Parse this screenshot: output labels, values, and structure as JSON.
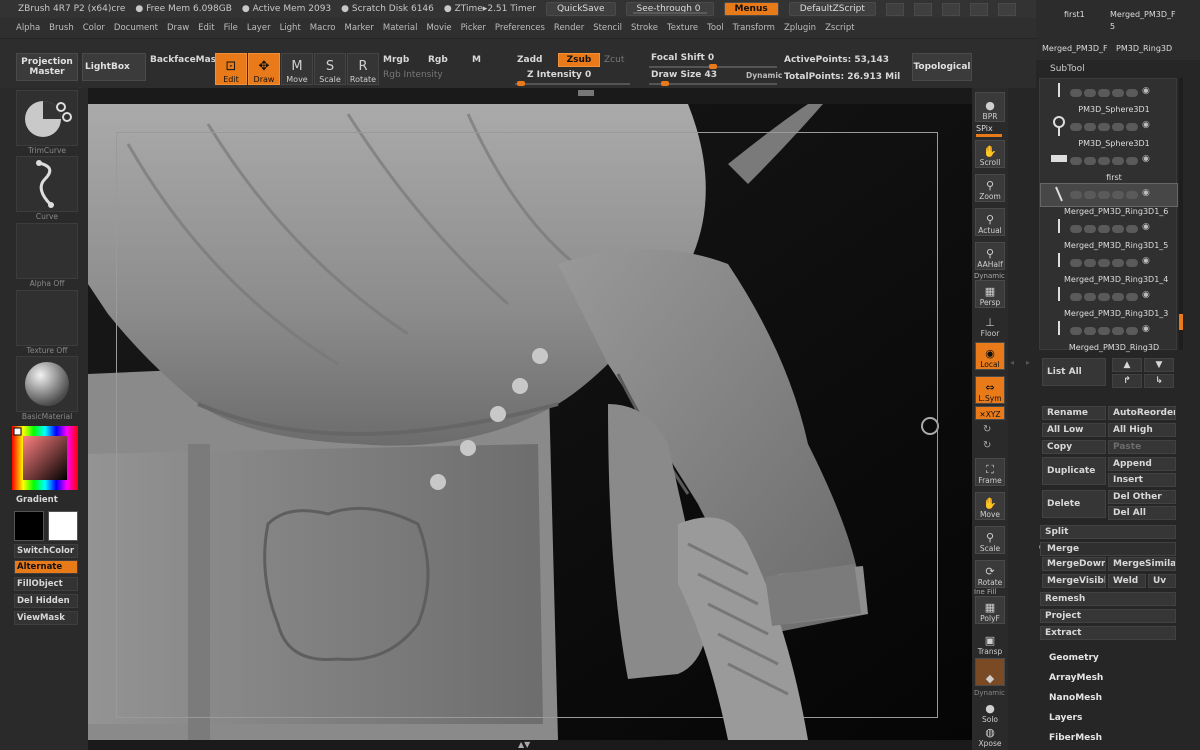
{
  "titlebar": {
    "app": "ZBrush 4R7 P2 (x64)cre",
    "free_mem": "● Free Mem 6.098GB",
    "active_mem": "● Active Mem 2093",
    "scratch": "● Scratch Disk 6146",
    "ztime": "● ZTime▸2.51 Timer",
    "quicksave": "QuickSave",
    "see_through": "See-through  0",
    "menus": "Menus",
    "script": "DefaultZScript"
  },
  "menus": [
    "Alpha",
    "Brush",
    "Color",
    "Document",
    "Draw",
    "Edit",
    "File",
    "Layer",
    "Light",
    "Macro",
    "Marker",
    "Material",
    "Movie",
    "Picker",
    "Preferences",
    "Render",
    "Stencil",
    "Stroke",
    "Texture",
    "Tool",
    "Transform",
    "Zplugin",
    "Zscript"
  ],
  "toolbar": {
    "projection_master": "Projection Master",
    "lightbox": "LightBox",
    "backface": "BackfaceMas",
    "edit": "Edit",
    "draw": "Draw",
    "move": "Move",
    "scale": "Scale",
    "rotate": "Rotate",
    "mrgb": "Mrgb",
    "rgb": "Rgb",
    "m": "M",
    "rgb_intensity": "Rgb Intensity",
    "zadd": "Zadd",
    "zsub": "Zsub",
    "zcut": "Zcut",
    "z_intensity": "Z Intensity 0",
    "focal_shift": "Focal Shift 0",
    "draw_size": "Draw Size 43",
    "dynamic": "Dynamic",
    "active_points": "ActivePoints: 53,143",
    "total_points": "TotalPoints: 26.913 Mil",
    "topological": "Topological"
  },
  "left": {
    "trimcurve": "TrimCurve",
    "curve": "Curve",
    "alpha_off": "Alpha Off",
    "texture_off": "Texture Off",
    "material": "BasicMaterial",
    "gradient": "Gradient",
    "switchcolor": "SwitchColor",
    "alternate": "Alternate",
    "fillobject": "FillObject",
    "del_hidden": "Del Hidden",
    "viewmask": "ViewMask"
  },
  "right_shelf": {
    "bpr": "BPR",
    "spix": "SPix",
    "scroll": "Scroll",
    "zoom": "Zoom",
    "actual": "Actual",
    "aahalf": "AAHalf",
    "dynamic": "Dynamic",
    "persp": "Persp",
    "floor": "Floor",
    "local": "Local",
    "lsym": "L.Sym",
    "xyz": "✕XYZ",
    "frame": "Frame",
    "move": "Move",
    "scale": "Scale",
    "rotate": "Rotate",
    "line_fill": "Ine Fill",
    "polyf": "PolyF",
    "transp": "Transp",
    "dynamic2": "Dynamic",
    "solo": "Solo",
    "xpose": "Xpose"
  },
  "thumbs": {
    "a": "first1",
    "b": "Merged_PM3D_F",
    "c": "5",
    "d": "Merged_PM3D_F",
    "e": "PM3D_Ring3D"
  },
  "subtool": {
    "header": "SubTool",
    "rows": [
      {
        "name": "PM3D_Sphere3D1"
      },
      {
        "name": "PM3D_Sphere3D1"
      },
      {
        "name": "first"
      },
      {
        "name": "Merged_PM3D_Ring3D1_6"
      },
      {
        "name": "Merged_PM3D_Ring3D1_5"
      },
      {
        "name": "Merged_PM3D_Ring3D1_4"
      },
      {
        "name": "Merged_PM3D_Ring3D1_3"
      },
      {
        "name": "Merged_PM3D_Ring3D"
      }
    ]
  },
  "panel": {
    "list_all": "List All",
    "rename": "Rename",
    "autoreorder": "AutoReorder",
    "all_low": "All Low",
    "all_high": "All High",
    "copy": "Copy",
    "paste": "Paste",
    "duplicate": "Duplicate",
    "append": "Append",
    "insert": "Insert",
    "delete": "Delete",
    "del_other": "Del Other",
    "del_all": "Del All",
    "split": "Split",
    "merge": "Merge",
    "mergedown": "MergeDown",
    "mergesimilar": "MergeSimilar",
    "mergevisible": "MergeVisible",
    "weld": "Weld",
    "uv": "Uv",
    "remesh": "Remesh",
    "project": "Project",
    "extract": "Extract",
    "geometry": "Geometry",
    "arraymesh": "ArrayMesh",
    "nanomesh": "NanoMesh",
    "layers": "Layers",
    "fibermesh": "FiberMesh"
  },
  "colors": {
    "accent": "#e87a1a",
    "bg": "#2b2b2b",
    "canvas": "#0b0b0b",
    "mesh": "#8a8a8a"
  }
}
